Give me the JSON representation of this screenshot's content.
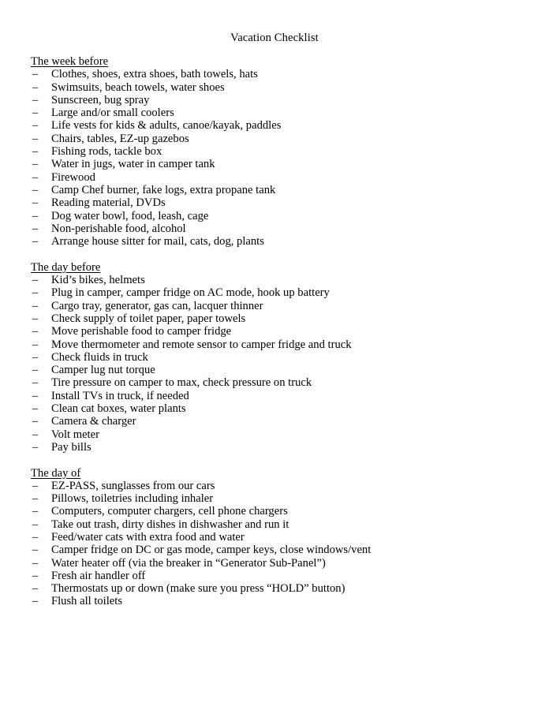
{
  "document": {
    "title": "Vacation Checklist",
    "bullet_char": "–",
    "text_color": "#000000",
    "background_color": "#ffffff",
    "sections": [
      {
        "heading": "The week before",
        "items": [
          "Clothes, shoes, extra shoes, bath towels, hats",
          "Swimsuits, beach towels, water shoes",
          "Sunscreen, bug spray",
          "Large and/or small coolers",
          "Life vests for kids & adults, canoe/kayak, paddles",
          "Chairs, tables, EZ-up gazebos",
          "Fishing rods, tackle box",
          "Water in jugs, water in camper tank",
          "Firewood",
          "Camp Chef burner, fake logs, extra propane tank",
          "Reading material, DVDs",
          "Dog water bowl, food, leash, cage",
          "Non-perishable food, alcohol",
          "Arrange house sitter for mail, cats, dog, plants"
        ]
      },
      {
        "heading": "The day before",
        "items": [
          "Kid’s bikes, helmets",
          "Plug in camper, camper fridge on AC mode, hook up battery",
          "Cargo tray, generator, gas can, lacquer thinner",
          "Check supply of toilet paper, paper towels",
          "Move perishable food to camper fridge",
          "Move thermometer and remote sensor to camper fridge and truck",
          "Check fluids in truck",
          "Camper lug nut torque",
          "Tire pressure on camper to max, check pressure on truck",
          "Install TVs in truck, if needed",
          "Clean cat boxes, water plants",
          "Camera & charger",
          "Volt meter",
          "Pay bills"
        ]
      },
      {
        "heading": "The day of",
        "items": [
          "EZ-PASS, sunglasses from our cars",
          "Pillows, toiletries including inhaler",
          "Computers, computer chargers, cell phone chargers",
          "Take out trash, dirty dishes in dishwasher and run it",
          "Feed/water cats with extra food and water",
          "Camper fridge on DC or gas mode, camper keys, close windows/vent",
          "Water heater off (via the breaker in “Generator Sub-Panel”)",
          "Fresh air handler off",
          "Thermostats up or down (make sure you press “HOLD” button)",
          "Flush all toilets"
        ]
      }
    ]
  }
}
